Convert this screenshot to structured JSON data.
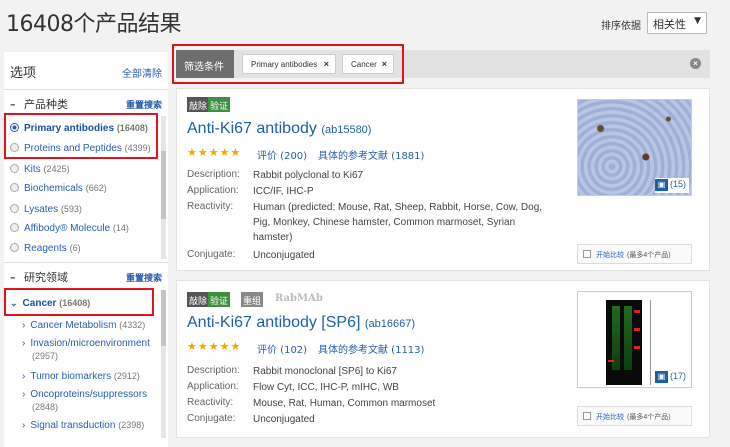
{
  "header": {
    "results_title": "16408个产品结果",
    "sort_label": "排序依据",
    "sort_value": "相关性"
  },
  "sidebar": {
    "title": "选项",
    "clear_all": "全部清除",
    "sections": [
      {
        "title": "产品种类",
        "reset": "重置搜索",
        "items": [
          {
            "label": "Primary antibodies",
            "count": "(16408)",
            "selected": true
          },
          {
            "label": "Proteins and Peptides",
            "count": "(4399)",
            "selected": false
          },
          {
            "label": "Kits",
            "count": "(2425)",
            "selected": false
          },
          {
            "label": "Biochemicals",
            "count": "(662)",
            "selected": false
          },
          {
            "label": "Lysates",
            "count": "(593)",
            "selected": false
          },
          {
            "label": "Affibody® Molecule",
            "count": "(14)",
            "selected": false
          },
          {
            "label": "Reagents",
            "count": "(6)",
            "selected": false
          }
        ]
      },
      {
        "title": "研究领域",
        "reset": "重置搜索",
        "selected": {
          "label": "Cancer",
          "count": "(16408)"
        },
        "sub_items": [
          {
            "label": "Cancer Metabolism",
            "count": "(4332)"
          },
          {
            "label": "Invasion/microenvironment",
            "count": "(2957)"
          },
          {
            "label": "Tumor biomarkers",
            "count": "(2912)"
          },
          {
            "label": "Oncoproteins/suppressors",
            "count": "(2848)"
          },
          {
            "label": "Signal transduction",
            "count": "(2398)"
          }
        ]
      }
    ]
  },
  "filter_bar": {
    "label": "筛选条件",
    "tags": [
      {
        "label": "Primary antibodies"
      },
      {
        "label": "Cancer"
      }
    ],
    "close_symbol": "×",
    "clear_symbol": "×"
  },
  "products": [
    {
      "badges": [
        "敲除",
        "验证"
      ],
      "name": "Anti-Ki67 antibody",
      "code": "(ab15580)",
      "stars": "★★★★★",
      "rating": "评价 (200)",
      "refs": "具体的参考文献 (1881)",
      "fields": [
        {
          "label": "Description:",
          "value": "Rabbit polyclonal to Ki67"
        },
        {
          "label": "Application:",
          "value": "ICC/IF, IHC-P"
        },
        {
          "label": "Reactivity:",
          "value": "Human (predicted: Mouse, Rat, Sheep, Rabbit, Horse, Cow, Dog, Pig, Monkey, Chinese hamster, Common marmoset, Syrian hamster)"
        },
        {
          "label": "Conjugate:",
          "value": "Unconjugated"
        }
      ],
      "image_count": "(15)",
      "compare": "开始比较",
      "compare_note": "(最多4个产品)"
    },
    {
      "badges": [
        "敲除",
        "验证",
        "重组"
      ],
      "brand": "RabMAb",
      "name": "Anti-Ki67 antibody [SP6]",
      "code": "(ab16667)",
      "stars": "★★★★★",
      "rating": "评价 (102)",
      "refs": "具体的参考文献 (1113)",
      "fields": [
        {
          "label": "Description:",
          "value": "Rabbit monoclonal [SP6] to Ki67"
        },
        {
          "label": "Application:",
          "value": "Flow Cyt, ICC, IHC-P, mIHC, WB"
        },
        {
          "label": "Reactivity:",
          "value": "Mouse, Rat, Human, Common marmoset"
        },
        {
          "label": "Conjugate:",
          "value": "Unconjugated"
        }
      ],
      "image_count": "(17)",
      "compare": "开始比较",
      "compare_note": "(最多4个产品)"
    }
  ],
  "colors": {
    "link": "#2a5db0",
    "highlight_box": "#e0141e",
    "validated_badge": "#3d8f3d",
    "stars": "#f0a800"
  },
  "icons": [
    "camera-icon",
    "close-icon",
    "chevron-down-icon",
    "chevron-right-icon",
    "minus-icon",
    "clear-filters-icon"
  ]
}
